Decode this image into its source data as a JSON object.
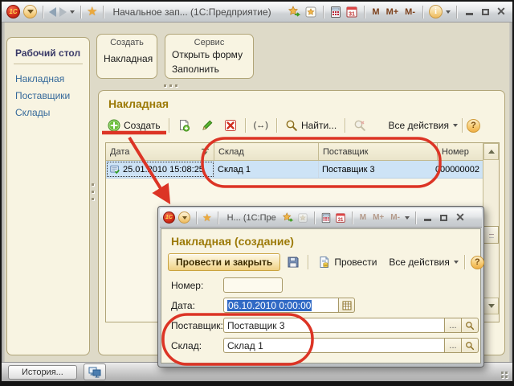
{
  "titlebar": {
    "title": "Начальное зап... (1С:Предприятие)",
    "memory": [
      "M",
      "M+",
      "M-"
    ]
  },
  "sidebar": {
    "title": "Рабочий стол",
    "items": [
      {
        "label": "Накладная"
      },
      {
        "label": "Поставщики"
      },
      {
        "label": "Склады"
      }
    ]
  },
  "panels": {
    "create": {
      "title": "Создать",
      "items": [
        {
          "label": "Накладная"
        }
      ]
    },
    "service": {
      "title": "Сервис",
      "items": [
        {
          "label": "Открыть форму"
        },
        {
          "label": "Заполнить"
        }
      ]
    }
  },
  "main": {
    "heading": "Накладная",
    "toolbar": {
      "create": "Создать",
      "find": "Найти...",
      "all_actions": "Все действия",
      "help": "?"
    },
    "table": {
      "columns": [
        {
          "label": "Дата"
        },
        {
          "label": "Склад"
        },
        {
          "label": "Поставщик"
        },
        {
          "label": "Номер"
        }
      ],
      "row": {
        "date": "25.01.2010 15:08:25",
        "warehouse": "Склад 1",
        "supplier": "Поставщик 3",
        "number": "000000002"
      }
    }
  },
  "dialog": {
    "title": "Н... (1С:Пре",
    "heading": "Накладная (создание)",
    "toolbar": {
      "post_and_close": "Провести и закрыть",
      "post": "Провести",
      "all_actions": "Все действия",
      "help": "?"
    },
    "choose": "...",
    "fields": {
      "number": {
        "label": "Номер:",
        "value": ""
      },
      "date": {
        "label": "Дата:",
        "value": "06.10.2010  0:00:00"
      },
      "supplier": {
        "label": "Поставщик:",
        "value": "Поставщик 3"
      },
      "warehouse": {
        "label": "Склад:",
        "value": "Склад 1"
      }
    }
  },
  "statusbar": {
    "history": "История..."
  },
  "colors": {
    "annotation_red": "#dc3425",
    "heading_gold": "#9c7a08",
    "link_blue": "#34689a",
    "panel_bg": "#f8f4e2",
    "panel_border": "#b0a477",
    "selection_row": "#cde3f6",
    "selection_text_bg": "#316ac5"
  }
}
